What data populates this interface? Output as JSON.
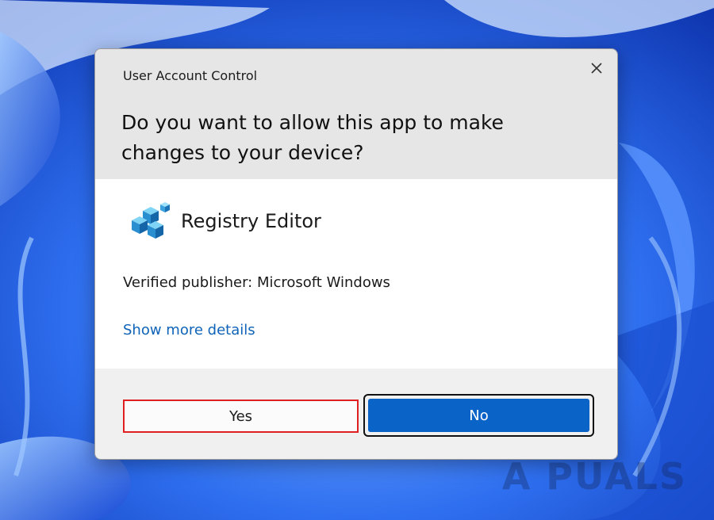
{
  "dialog": {
    "title": "User Account Control",
    "question": "Do you want to allow this app to make changes to your device?",
    "app_name": "Registry Editor",
    "publisher": "Verified publisher: Microsoft Windows",
    "details_link": "Show more details",
    "yes_label": "Yes",
    "no_label": "No",
    "close_icon": "close-icon",
    "app_icon": "registry-editor-icon"
  },
  "watermark": {
    "text": "A  PUALS"
  },
  "colors": {
    "accent": "#0a64c8",
    "link": "#0f63b8",
    "header_bg": "#e6e6e6",
    "footer_bg": "#f0f0f0",
    "yes_highlight": "#e02020"
  }
}
